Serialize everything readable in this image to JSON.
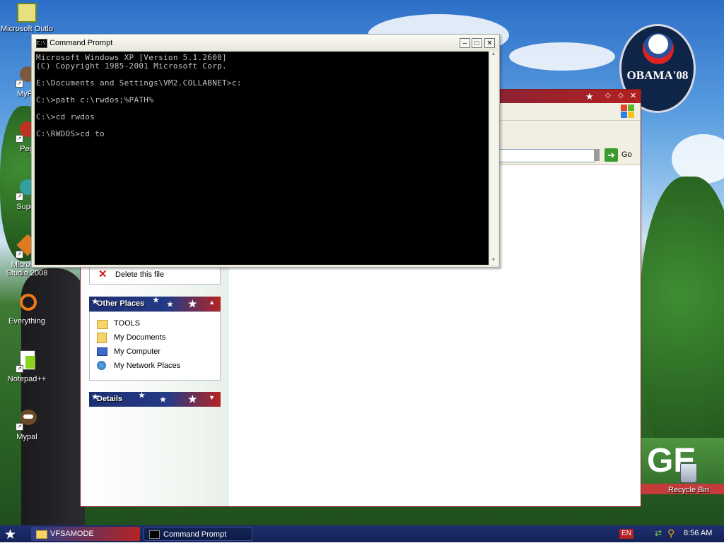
{
  "desktop": {
    "icons": [
      {
        "label": "Microsoft Outlo",
        "icon": "outlook-icon"
      },
      {
        "label": "MyPa",
        "icon": "mypal-icon"
      },
      {
        "label": "Peg",
        "icon": "pegasus-icon"
      },
      {
        "label": "Super",
        "icon": "super-icon"
      },
      {
        "label": "Microsoft Studio 2008",
        "icon": "visual-studio-icon"
      },
      {
        "label": "Everything",
        "icon": "everything-search-icon"
      },
      {
        "label": "Notepad++",
        "icon": "notepadpp-icon"
      },
      {
        "label": "Mypal",
        "icon": "mypal-icon"
      }
    ],
    "badge_text": "OBAMA'08",
    "recycle_bin_label": "Recycle Bin"
  },
  "explorer": {
    "address_go_label": "Go",
    "tasks_partial_item": "Delete this file",
    "other_places": {
      "title": "Other Places",
      "items": [
        {
          "label": "TOOLS",
          "icon": "folder-icon"
        },
        {
          "label": "My Documents",
          "icon": "my-documents-icon"
        },
        {
          "label": "My Computer",
          "icon": "my-computer-icon"
        },
        {
          "label": "My Network Places",
          "icon": "network-places-icon"
        }
      ]
    },
    "details": {
      "title": "Details"
    }
  },
  "cmd": {
    "title": "Command Prompt",
    "lines": [
      "Microsoft Windows XP [Version 5.1.2600]",
      "(C) Copyright 1985-2001 Microsoft Corp.",
      "",
      "E:\\Documents and Settings\\VM2.COLLABNET>c:",
      "",
      "C:\\>path c:\\rwdos;%PATH%",
      "",
      "C:\\>cd rwdos",
      "",
      "C:\\RWDOS>cd to"
    ]
  },
  "taskbar": {
    "start_icon": "star-icon",
    "tasks": [
      {
        "label": "VFSAMODE",
        "icon": "folder-icon"
      },
      {
        "label": "Command Prompt",
        "icon": "cmd-icon"
      }
    ],
    "language": "EN",
    "clock": "8:56 AM"
  },
  "colors": {
    "flag_blue": "#1e2f73",
    "flag_red": "#b42424",
    "taskbar": "#1f2f6f",
    "console_bg": "#000000",
    "console_text": "#c0c0c0"
  }
}
